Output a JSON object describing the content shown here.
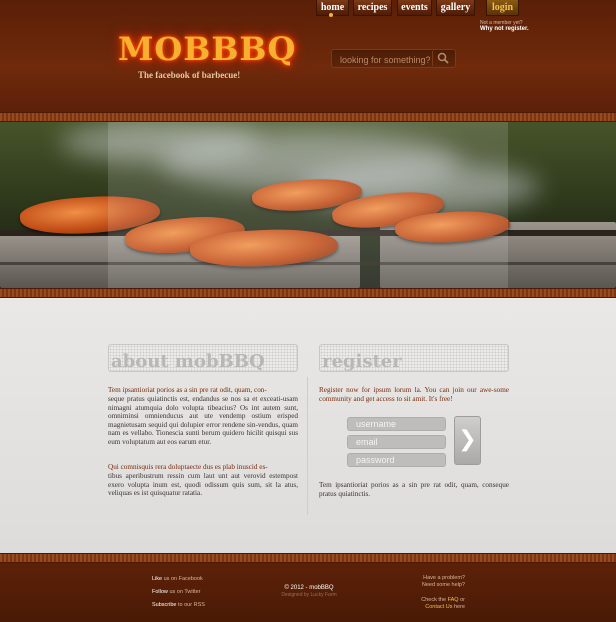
{
  "header": {
    "logo_text": "MOBBBQ",
    "tagline": "The facebook of barbecue!",
    "nav": {
      "home": "home",
      "recipes": "recipes",
      "events": "events",
      "gallery": "gallery",
      "login": "login"
    },
    "member_prompt": "Not a member yet?",
    "register_link": "Why not register.",
    "search_placeholder": "looking for something?"
  },
  "about": {
    "title": "about mobBBQ",
    "lead": "Tem ipsantioriat porios as a sin pre rat odit, quam, con-",
    "body1": "seque pratus quiatinctis est, endandus se nos sa et exceati-usam nimagni atumquia dolo volupta tibeacius? Os int autem sunt, omniminsi omnienducus aut ute vendemp ostium erisped magnietusam sequid qui dolupier error rendene sin-vendus, quam nam es vellabo. Tionescia sunti berum quidero hicilit quisqui sus eum voluptatum aut eos earum etur.",
    "lead2": "Qui comnisquis rera doluptaecte dus es plab inuscid es-",
    "body2": "tibus aperibustrum ressin cum laut unt aut verovid estempost exero volupta inum est, quodi odissum quis sum, sit la atus, veliquas es ist quisquatur ratatia."
  },
  "register": {
    "title": "register",
    "lead": "Register now for ipsum lorum la. You can join our awe-some community and get access to sit amit. It's free!",
    "username_placeholder": "username",
    "email_placeholder": "email",
    "password_placeholder": "password",
    "submit_glyph": "❯",
    "footnote": "Tem ipsantioriat porios as a sin pre rat odit, quam, conseque pratus quiatinctis."
  },
  "footer": {
    "like": "Like",
    "like_rest": "us on Facebook",
    "follow": "Follow",
    "follow_rest": "us on Twitter",
    "subscribe": "Subscribe",
    "subscribe_rest": "to our RSS",
    "copyright": "© 2012 - mobBBQ",
    "designer": "Designed by Lucky Farm",
    "problem1": "Have a problem?",
    "problem2": "Need some help?",
    "faq_pre": "Check the",
    "faq_link": "FAQ",
    "faq_post": "or",
    "contact_pre": "Contact Us",
    "contact_post": "here"
  }
}
